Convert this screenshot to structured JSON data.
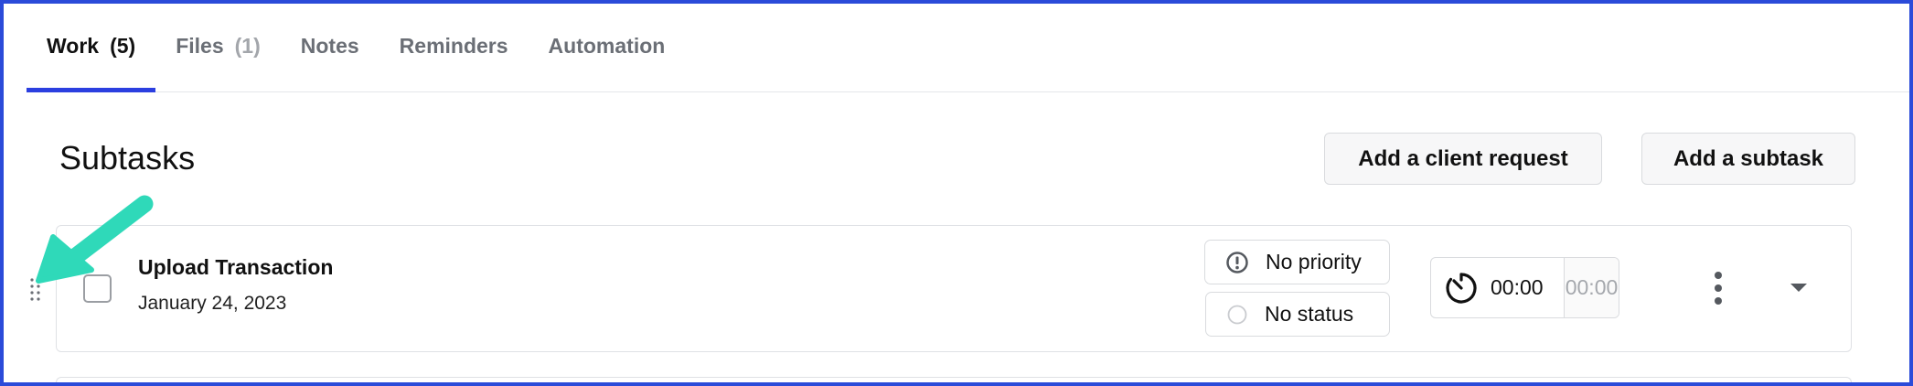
{
  "tabs": [
    {
      "label": "Work",
      "count": "(5)",
      "active": true
    },
    {
      "label": "Files",
      "count": "(1)",
      "active": false
    },
    {
      "label": "Notes",
      "count": "",
      "active": false
    },
    {
      "label": "Reminders",
      "count": "",
      "active": false
    },
    {
      "label": "Automation",
      "count": "",
      "active": false
    }
  ],
  "section": {
    "title": "Subtasks",
    "add_client_request_label": "Add a client request",
    "add_subtask_label": "Add a subtask"
  },
  "subtask": {
    "title": "Upload Transaction",
    "date": "January 24, 2023",
    "priority": "No priority",
    "status": "No status",
    "timer_elapsed": "00:00",
    "timer_estimate": "00:00"
  },
  "colors": {
    "frame_border": "#2b4bd9",
    "active_tab_underline": "#2b3fe0",
    "annotation_arrow": "#2fd9b9"
  },
  "icons": {
    "priority": "exclamation-circle-icon",
    "status": "empty-circle-icon",
    "timer": "stopwatch-icon",
    "more": "kebab-menu-icon",
    "expand": "caret-down-icon",
    "drag": "drag-handle-icon"
  }
}
